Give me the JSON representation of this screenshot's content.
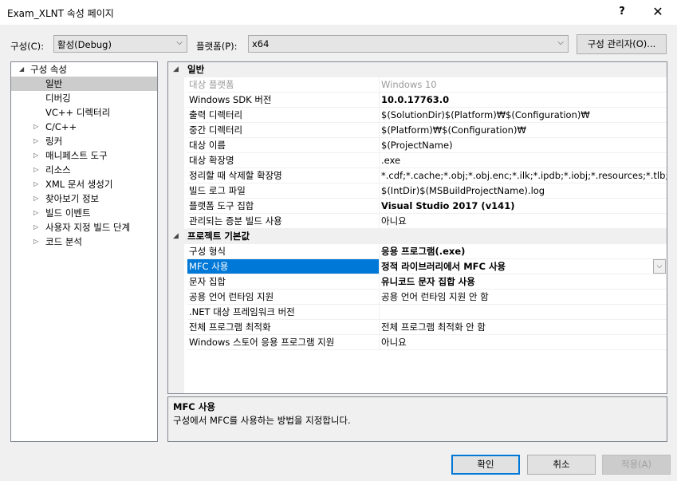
{
  "window": {
    "title": "Exam_XLNT 속성 페이지",
    "help_label": "?",
    "close_label": "✕"
  },
  "toolbar": {
    "config_label": "구성(C):",
    "config_value": "활성(Debug)",
    "platform_label": "플랫폼(P):",
    "platform_value": "x64",
    "config_manager_label": "구성 관리자(O)..."
  },
  "tree": [
    {
      "label": "구성 속성",
      "exp": "◢",
      "indent": 0
    },
    {
      "label": "일반",
      "exp": "",
      "indent": 2,
      "selected": true
    },
    {
      "label": "디버깅",
      "exp": "",
      "indent": 2
    },
    {
      "label": "VC++ 디렉터리",
      "exp": "",
      "indent": 2
    },
    {
      "label": "C/C++",
      "exp": "▷",
      "indent": 1
    },
    {
      "label": "링커",
      "exp": "▷",
      "indent": 1
    },
    {
      "label": "매니페스트 도구",
      "exp": "▷",
      "indent": 1
    },
    {
      "label": "리소스",
      "exp": "▷",
      "indent": 1
    },
    {
      "label": "XML 문서 생성기",
      "exp": "▷",
      "indent": 1
    },
    {
      "label": "찾아보기 정보",
      "exp": "▷",
      "indent": 1
    },
    {
      "label": "빌드 이벤트",
      "exp": "▷",
      "indent": 1
    },
    {
      "label": "사용자 지정 빌드 단계",
      "exp": "▷",
      "indent": 1
    },
    {
      "label": "코드 분석",
      "exp": "▷",
      "indent": 1
    }
  ],
  "grid": [
    {
      "type": "cat",
      "name": "일반",
      "exp": "◢"
    },
    {
      "name": "대상 플랫폼",
      "value": "Windows 10",
      "disabled": true
    },
    {
      "name": "Windows SDK 버전",
      "value": "10.0.17763.0",
      "bold": true
    },
    {
      "name": "출력 디렉터리",
      "value": "$(SolutionDir)$(Platform)₩$(Configuration)₩"
    },
    {
      "name": "중간 디렉터리",
      "value": "$(Platform)₩$(Configuration)₩"
    },
    {
      "name": "대상 이름",
      "value": "$(ProjectName)"
    },
    {
      "name": "대상 확장명",
      "value": ".exe"
    },
    {
      "name": "정리할 때 삭제할 확장명",
      "value": "*.cdf;*.cache;*.obj;*.obj.enc;*.ilk;*.ipdb;*.iobj;*.resources;*.tlb;*.tli;*.tl"
    },
    {
      "name": "빌드 로그 파일",
      "value": "$(IntDir)$(MSBuildProjectName).log"
    },
    {
      "name": "플랫폼 도구 집합",
      "value": "Visual Studio 2017 (v141)",
      "bold": true
    },
    {
      "name": "관리되는 증분 빌드 사용",
      "value": "아니요"
    },
    {
      "type": "cat",
      "name": "프로젝트 기본값",
      "exp": "◢"
    },
    {
      "name": "구성 형식",
      "value": "응용 프로그램(.exe)",
      "bold": true
    },
    {
      "name": "MFC 사용",
      "value": "정적 라이브러리에서 MFC 사용",
      "bold": true,
      "selected": true
    },
    {
      "name": "문자 집합",
      "value": "유니코드 문자 집합 사용",
      "bold": true
    },
    {
      "name": "공용 언어 런타임 지원",
      "value": "공용 언어 런타임 지원 안 함"
    },
    {
      "name": ".NET 대상 프레임워크 버전",
      "value": ""
    },
    {
      "name": "전체 프로그램 최적화",
      "value": "전체 프로그램 최적화 안 함"
    },
    {
      "name": "Windows 스토어 응용 프로그램 지원",
      "value": "아니요"
    }
  ],
  "dropdown_arrow": "⌵",
  "description": {
    "title": "MFC 사용",
    "text": "구성에서 MFC를 사용하는 방법을 지정합니다."
  },
  "buttons": {
    "ok": "확인",
    "cancel": "취소",
    "apply": "적용(A)"
  },
  "colors": {
    "selection": "#0078d7",
    "tree_selection": "#cccccc"
  }
}
